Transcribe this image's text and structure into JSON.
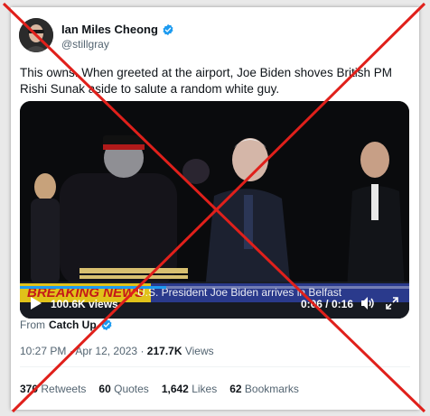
{
  "author": {
    "name": "Ian Miles Cheong",
    "handle": "@stillgray",
    "verified_color": "#1d9bf0"
  },
  "tweet": {
    "text": "This owns. When greeted at the airport, Joe Biden shoves British PM Rishi Sunak aside to salute a random white guy."
  },
  "video": {
    "banner": "BREAKING NEWS",
    "headline": "U.S. President Joe Biden arrives in Belfast",
    "views": "100.6K views",
    "time": "0:06 / 0:16",
    "progress": 0.375,
    "icons": [
      "play-icon",
      "volume-icon",
      "fullscreen-icon"
    ]
  },
  "source": {
    "prefix": "From",
    "name": "Catch Up"
  },
  "meta": {
    "time": "10:27 PM",
    "date": "Apr 12, 2023",
    "separator": "·",
    "views_count": "217.7K",
    "views_label": "Views"
  },
  "stats": {
    "retweets_count": "370",
    "retweets_label": "Retweets",
    "quotes_count": "60",
    "quotes_label": "Quotes",
    "likes_count": "1,642",
    "likes_label": "Likes",
    "bookmarks_count": "62",
    "bookmarks_label": "Bookmarks"
  },
  "overlay": {
    "cross_color": "#e0201b"
  }
}
